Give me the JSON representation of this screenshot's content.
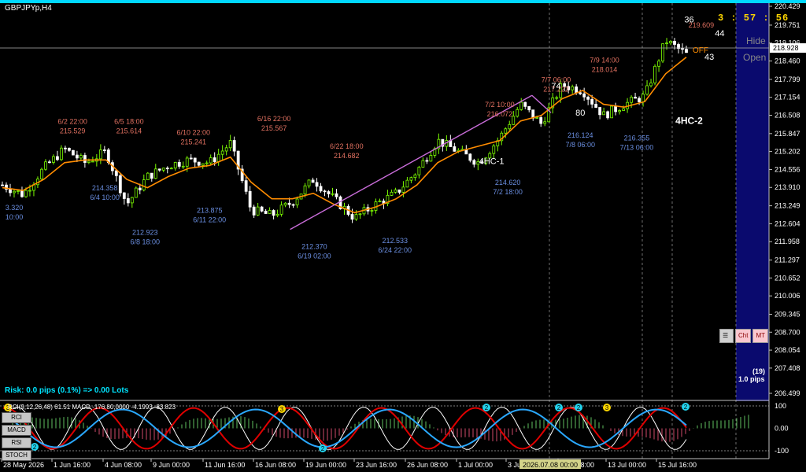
{
  "window": {
    "symbol": "GBPJPYp,H4",
    "timer": "3 : 57 : 56"
  },
  "risk_text": "Risk: 0.0 pips (0.1%) => 0.00 Lots",
  "panel": {
    "hide": "Hide",
    "open": "Open",
    "off": "OFF",
    "cht": "Cht",
    "mt": "MT",
    "list_icon": "list-icon",
    "pip_count": "(19)",
    "pip_value": "1.0 pips"
  },
  "indicator_tabs": [
    "RCI",
    "MACD",
    "RSI",
    "STOCH"
  ],
  "osc_header": "RCI(9,12,26,48) 61.51  MACD -176.80,0000 -4.1993 -83.823",
  "colors": {
    "bg": "#000000",
    "accent": "#00d8ff",
    "bull": "#7cfc00",
    "ma": "#ff8c00",
    "trend": "#c86cd8",
    "high_label": "#e07060",
    "low_label": "#6a8ee0",
    "timer": "#ffd700",
    "future_zone": "#0a0a6e"
  },
  "chart_data": {
    "type": "candlestick",
    "symbol": "GBPJPYp",
    "timeframe": "H4",
    "ylim": [
      206.499,
      220.429
    ],
    "yticks": [
      "220.429",
      "219.751",
      "219.106",
      "218.460",
      "217.799",
      "217.154",
      "216.508",
      "215.847",
      "215.202",
      "214.556",
      "213.910",
      "213.249",
      "212.604",
      "211.958",
      "211.297",
      "210.652",
      "210.006",
      "209.345",
      "208.700",
      "208.054",
      "207.408",
      "206.499"
    ],
    "current_price": "218.928",
    "xticks": [
      "28 May 2026",
      "1 Jun 16:00",
      "4 Jun 08:00",
      "9 Jun 00:00",
      "11 Jun 16:00",
      "16 Jun 08:00",
      "19 Jun 00:00",
      "23 Jun 16:00",
      "26 Jun 08:00",
      "1 Jul 00:00",
      "3 Jul 16:00",
      "8 Jul 08:00",
      "13 Jul 00:00",
      "15 Jul 16:00"
    ],
    "cursor_time": "2026.07.08 00:00",
    "price_path": [
      214.0,
      213.65,
      214.6,
      215.3,
      214.8,
      215.2,
      213.3,
      214.3,
      214.7,
      214.9,
      214.8,
      215.5,
      213.1,
      212.9,
      213.4,
      214.2,
      213.5,
      212.8,
      213.3,
      213.7,
      214.5,
      215.6,
      215.2,
      214.8,
      215.7,
      216.9,
      216.2,
      217.6,
      217.4,
      216.5,
      216.9,
      217.2,
      219.2,
      218.7
    ],
    "ma_path": [
      213.9,
      213.8,
      214.2,
      214.8,
      214.9,
      214.9,
      214.2,
      213.9,
      214.3,
      214.6,
      214.7,
      215.0,
      214.1,
      213.5,
      213.5,
      213.7,
      213.3,
      213.0,
      213.2,
      213.5,
      214.0,
      214.8,
      215.2,
      215.4,
      215.6,
      216.3,
      216.5,
      217.1,
      217.4,
      216.9,
      216.8,
      217.0,
      218.0,
      218.6
    ],
    "trendline": [
      [
        212.4,
        0.36
      ],
      [
        217.222,
        0.66
      ]
    ],
    "swing_labels": [
      {
        "kind": "low",
        "price": "3.320",
        "time": "10:00",
        "xf": 0.0,
        "p": 213.1
      },
      {
        "kind": "high",
        "price": "215.529",
        "time": "6/2 22:00",
        "xf": 0.09,
        "p": 216.2
      },
      {
        "kind": "high",
        "price": "215.614",
        "time": "6/5 18:00",
        "xf": 0.16,
        "p": 216.2
      },
      {
        "kind": "low",
        "price": "214.358",
        "time": "6/4 10:00",
        "xf": 0.13,
        "p": 213.8
      },
      {
        "kind": "low",
        "price": "212.923",
        "time": "6/8 18:00",
        "xf": 0.18,
        "p": 212.2
      },
      {
        "kind": "high",
        "price": "215.241",
        "time": "6/10 22:00",
        "xf": 0.24,
        "p": 215.8
      },
      {
        "kind": "low",
        "price": "213.875",
        "time": "6/11 22:00",
        "xf": 0.26,
        "p": 213.0
      },
      {
        "kind": "high",
        "price": "215.567",
        "time": "6/16 22:00",
        "xf": 0.34,
        "p": 216.3
      },
      {
        "kind": "high",
        "price": "214.682",
        "time": "6/22 18:00",
        "xf": 0.43,
        "p": 215.3
      },
      {
        "kind": "low",
        "price": "212.370",
        "time": "6/19 02:00",
        "xf": 0.39,
        "p": 211.7
      },
      {
        "kind": "low",
        "price": "212.533",
        "time": "6/24 22:00",
        "xf": 0.49,
        "p": 211.9
      },
      {
        "kind": "high",
        "price": "216.072",
        "time": "7/2 10:00",
        "xf": 0.62,
        "p": 216.8
      },
      {
        "kind": "low",
        "price": "214.620",
        "time": "7/2 18:00",
        "xf": 0.63,
        "p": 214.0
      },
      {
        "kind": "high",
        "price": "217.222",
        "time": "7/7 06:00",
        "xf": 0.69,
        "p": 217.7
      },
      {
        "kind": "low",
        "price": "216.124",
        "time": "7/8 06:00",
        "xf": 0.72,
        "p": 215.7
      },
      {
        "kind": "high",
        "price": "218.014",
        "time": "7/9 14:00",
        "xf": 0.75,
        "p": 218.4
      },
      {
        "kind": "low",
        "price": "216.355",
        "time": "7/13 06:00",
        "xf": 0.79,
        "p": 215.6
      },
      {
        "kind": "high",
        "price": "219.609",
        "time": "",
        "xf": 0.87,
        "p": 220.0
      }
    ],
    "annotations": [
      {
        "text": "74",
        "xf": 0.69,
        "p": 217.45,
        "color": "#ffffff",
        "bold": false
      },
      {
        "text": "80",
        "xf": 0.72,
        "p": 216.5,
        "color": "#ffffff",
        "bold": false
      },
      {
        "text": "4HC-1",
        "xf": 0.61,
        "p": 214.75,
        "color": "#ffffff",
        "bold": false
      },
      {
        "text": "4HC-2",
        "xf": 0.855,
        "p": 216.2,
        "color": "#ffffff",
        "bold": true
      },
      {
        "text": "36",
        "xf": 0.855,
        "p": 219.85,
        "color": "#ffffff",
        "bold": false
      },
      {
        "text": "44",
        "xf": 0.893,
        "p": 219.35,
        "color": "#ffffff",
        "bold": false
      },
      {
        "text": "43",
        "xf": 0.88,
        "p": 218.5,
        "color": "#ffffff",
        "bold": false
      }
    ],
    "oscillator": {
      "levels": [
        "100",
        "0.00",
        "-100"
      ]
    }
  }
}
